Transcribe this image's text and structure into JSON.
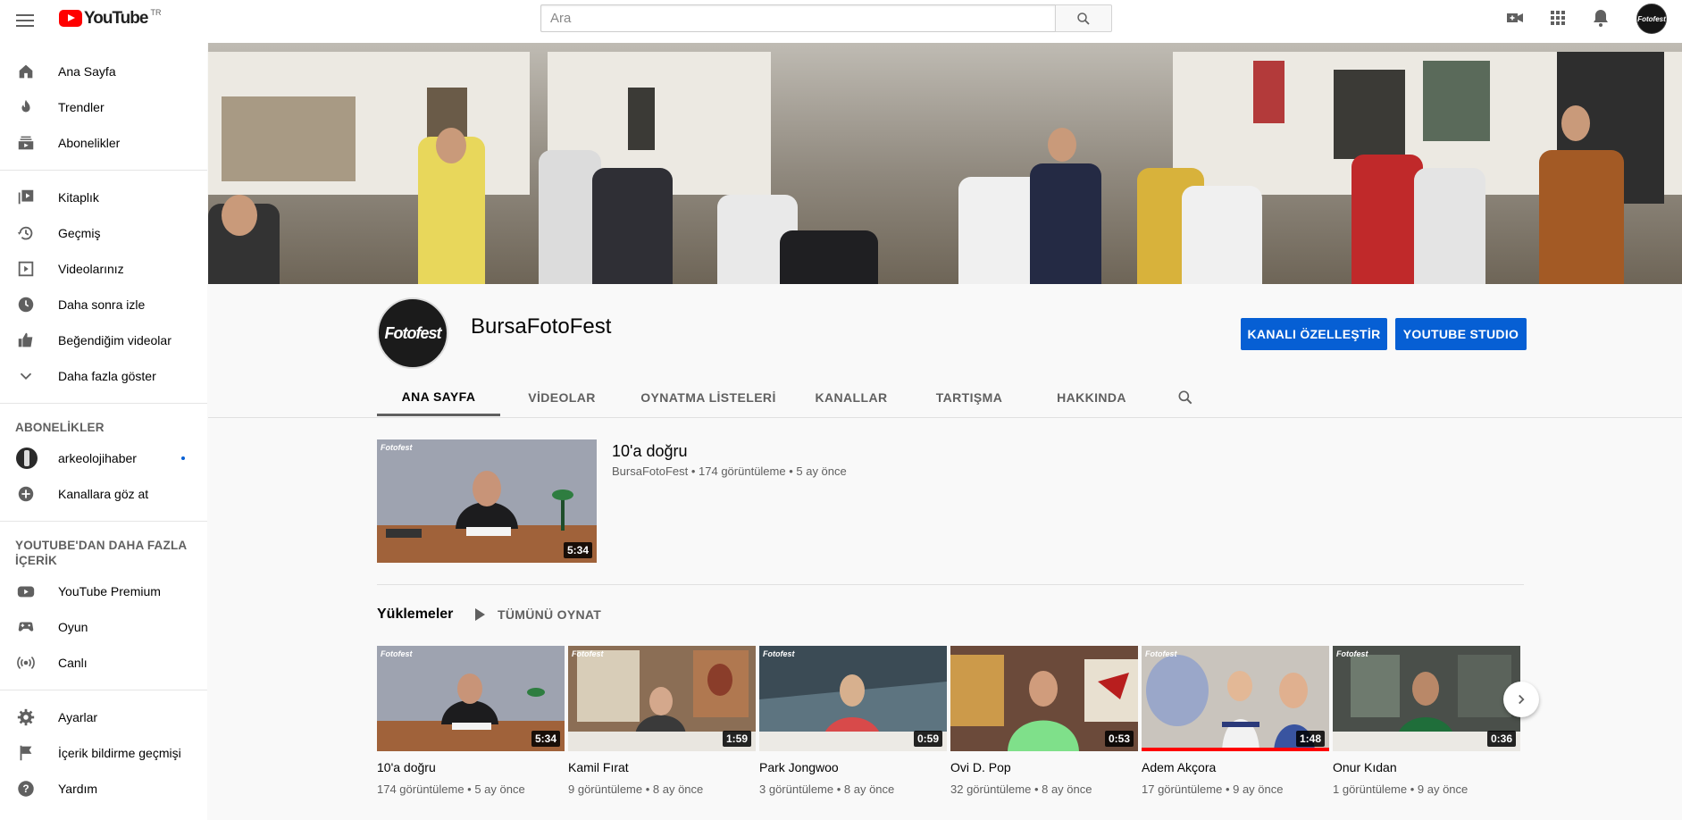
{
  "header": {
    "logo_text": "YouTube",
    "logo_country": "TR",
    "search_placeholder": "Ara",
    "icons": [
      "menu-icon",
      "search-icon",
      "video-camera-icon",
      "apps-grid-icon",
      "bell-icon",
      "account-avatar"
    ]
  },
  "sidebar": {
    "main": [
      {
        "label": "Ana Sayfa",
        "icon": "home-icon"
      },
      {
        "label": "Trendler",
        "icon": "flame-icon"
      },
      {
        "label": "Abonelikler",
        "icon": "subscriptions-icon"
      }
    ],
    "library": [
      {
        "label": "Kitaplık",
        "icon": "library-icon"
      },
      {
        "label": "Geçmiş",
        "icon": "history-icon"
      },
      {
        "label": "Videolarınız",
        "icon": "your-videos-icon"
      },
      {
        "label": "Daha sonra izle",
        "icon": "clock-icon"
      },
      {
        "label": "Beğendiğim videolar",
        "icon": "thumb-up-icon"
      },
      {
        "label": "Daha fazla göster",
        "icon": "chevron-down-icon"
      }
    ],
    "subscriptions_heading": "ABONELİKLER",
    "subscriptions": [
      {
        "label": "arkeolojihaber",
        "icon": "channel-avatar"
      },
      {
        "label": "Kanallara göz at",
        "icon": "add-circle-icon"
      }
    ],
    "more_heading": "YOUTUBE'DAN DAHA FAZLA İÇERİK",
    "more": [
      {
        "label": "YouTube Premium",
        "icon": "youtube-icon"
      },
      {
        "label": "Oyun",
        "icon": "gamepad-icon"
      },
      {
        "label": "Canlı",
        "icon": "live-icon"
      }
    ],
    "settings": [
      {
        "label": "Ayarlar",
        "icon": "gear-icon"
      },
      {
        "label": "İçerik bildirme geçmişi",
        "icon": "flag-icon"
      },
      {
        "label": "Yardım",
        "icon": "help-icon"
      }
    ]
  },
  "channel": {
    "name": "BursaFotoFest",
    "avatar_text": "Fotofest",
    "customize_button": "KANALI ÖZELLEŞTİR",
    "studio_button": "YOUTUBE STUDIO",
    "tabs": [
      "ANA SAYFA",
      "VİDEOLAR",
      "OYNATMA LİSTELERİ",
      "KANALLAR",
      "TARTIŞMA",
      "HAKKINDA"
    ],
    "active_tab": "ANA SAYFA"
  },
  "featured": {
    "title": "10'a doğru",
    "meta": "BursaFotoFest • 174 görüntüleme • 5 ay önce",
    "duration": "5:34"
  },
  "uploads": {
    "heading": "Yüklemeler",
    "play_all": "TÜMÜNÜ OYNAT",
    "videos": [
      {
        "title": "10'a doğru",
        "meta": "174 görüntüleme • 5 ay önce",
        "duration": "5:34",
        "progress": 0.0
      },
      {
        "title": "Kamil Fırat",
        "meta": "9 görüntüleme • 8 ay önce",
        "duration": "1:59",
        "progress": 0.0
      },
      {
        "title": "Park Jongwoo",
        "meta": "3 görüntüleme • 8 ay önce",
        "duration": "0:59",
        "progress": 0.0
      },
      {
        "title": "Ovi D. Pop",
        "meta": "32 görüntüleme • 8 ay önce",
        "duration": "0:53",
        "progress": 0.0
      },
      {
        "title": "Adem Akçora",
        "meta": "17 görüntüleme • 9 ay önce",
        "duration": "1:48",
        "progress": 1.0
      },
      {
        "title": "Onur Kıdan",
        "meta": "1 görüntüleme • 9 ay önce",
        "duration": "0:36",
        "progress": 0.0
      }
    ]
  },
  "colors": {
    "brand_red": "#ff0000",
    "accent_blue": "#065fd4",
    "text_secondary": "#606060"
  }
}
